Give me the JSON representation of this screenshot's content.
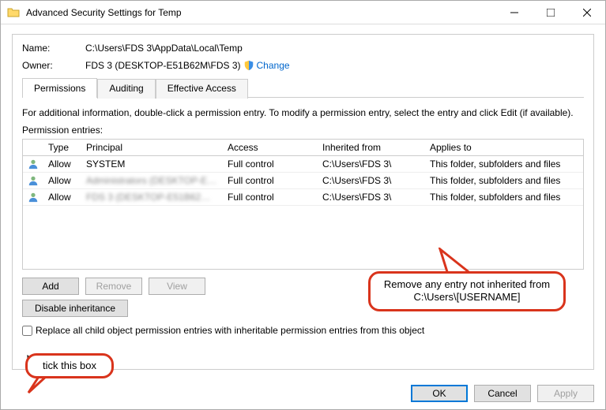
{
  "titlebar": {
    "title": "Advanced Security Settings for Temp"
  },
  "fields": {
    "name_label": "Name:",
    "name_value": "C:\\Users\\FDS 3\\AppData\\Local\\Temp",
    "owner_label": "Owner:",
    "owner_value": "FDS 3 (DESKTOP-E51B62M\\FDS 3)",
    "change_link": "Change"
  },
  "tabs": {
    "permissions": "Permissions",
    "auditing": "Auditing",
    "effective": "Effective Access"
  },
  "info_text": "For additional information, double-click a permission entry. To modify a permission entry, select the entry and click Edit (if available).",
  "entries_label": "Permission entries:",
  "columns": {
    "type": "Type",
    "principal": "Principal",
    "access": "Access",
    "inherited": "Inherited from",
    "applies": "Applies to"
  },
  "rows": [
    {
      "type": "Allow",
      "principal": "SYSTEM",
      "blur": false,
      "access": "Full control",
      "inherited": "C:\\Users\\FDS 3\\",
      "applies": "This folder, subfolders and files"
    },
    {
      "type": "Allow",
      "principal": "Administrators (DESKTOP-E51...",
      "blur": true,
      "access": "Full control",
      "inherited": "C:\\Users\\FDS 3\\",
      "applies": "This folder, subfolders and files"
    },
    {
      "type": "Allow",
      "principal": "FDS 3 (DESKTOP-E51B62M\\FD...",
      "blur": true,
      "access": "Full control",
      "inherited": "C:\\Users\\FDS 3\\",
      "applies": "This folder, subfolders and files"
    }
  ],
  "buttons": {
    "add": "Add",
    "remove": "Remove",
    "view": "View",
    "disable": "Disable inheritance"
  },
  "checkbox_label": "Replace all child object permission entries with inheritable permission entries from this object",
  "footer": {
    "ok": "OK",
    "cancel": "Cancel",
    "apply": "Apply"
  },
  "annotations": {
    "big": "Remove any entry not inherited from C:\\Users\\[USERNAME]",
    "small": "tick this box"
  }
}
